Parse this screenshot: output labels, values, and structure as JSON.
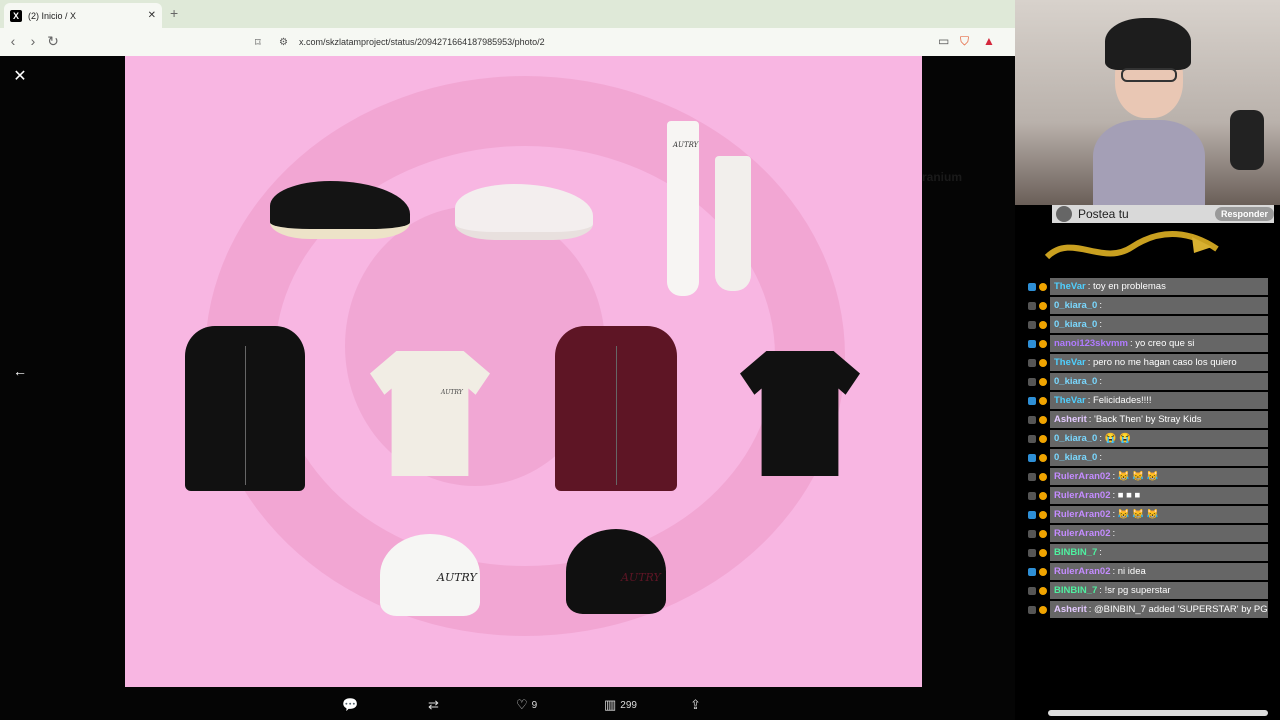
{
  "browser": {
    "tab_title": "(2) Inicio / X",
    "tab_favicon": "X",
    "url": "x.com/skzlatamproject/status/2094271664187985953/photo/2"
  },
  "viewer": {
    "brand_text": "AUTRY",
    "sidepeek_text": "ranium",
    "actions": {
      "replies": "",
      "reposts": "",
      "likes": "9",
      "views": "299"
    }
  },
  "chat": {
    "header_text": "Postea tu",
    "header_button": "Responder",
    "messages": [
      {
        "user": "TheVar",
        "text": ": toy en problemas",
        "color": "#4fd0ff"
      },
      {
        "user": "0_kiara_0",
        "text": ": ",
        "color": "#7ad8ff"
      },
      {
        "user": "0_kiara_0",
        "text": ": ",
        "color": "#7ad8ff"
      },
      {
        "user": "nanoi123skvmm",
        "text": ": yo creo que si",
        "color": "#b07bff"
      },
      {
        "user": "TheVar",
        "text": ": pero no me hagan caso los quiero",
        "color": "#4fd0ff"
      },
      {
        "user": "0_kiara_0",
        "text": ": ",
        "color": "#7ad8ff"
      },
      {
        "user": "TheVar",
        "text": ": Felicidades!!!!",
        "color": "#4fd0ff"
      },
      {
        "user": "Asherit",
        "text": ": 'Back Then' by Stray Kids",
        "color": "#e3c9ff"
      },
      {
        "user": "0_kiara_0",
        "text": ": 😭 😭",
        "color": "#7ad8ff"
      },
      {
        "user": "0_kiara_0",
        "text": ": ",
        "color": "#7ad8ff"
      },
      {
        "user": "RulerAran02",
        "text": ": 😹 😹 😹",
        "color": "#c48cff"
      },
      {
        "user": "RulerAran02",
        "text": ": ■ ■ ■",
        "color": "#c48cff"
      },
      {
        "user": "RulerAran02",
        "text": ": 😹 😹 😹",
        "color": "#c48cff"
      },
      {
        "user": "RulerAran02",
        "text": ": ",
        "color": "#c48cff"
      },
      {
        "user": "BINBIN_7",
        "text": ": ",
        "color": "#4ff0a0"
      },
      {
        "user": "RulerAran02",
        "text": ": ni idea",
        "color": "#c48cff"
      },
      {
        "user": "BINBIN_7",
        "text": ": !sr pg superstar",
        "color": "#4ff0a0"
      },
      {
        "user": "Asherit",
        "text": ": @BINBIN_7 added 'SUPERSTAR' by PG.",
        "color": "#e3c9ff"
      }
    ]
  },
  "colors": {
    "photo_bg": "#f8b6e2",
    "swirl": "#ef9fcd",
    "chat_bubble": "#787878"
  }
}
